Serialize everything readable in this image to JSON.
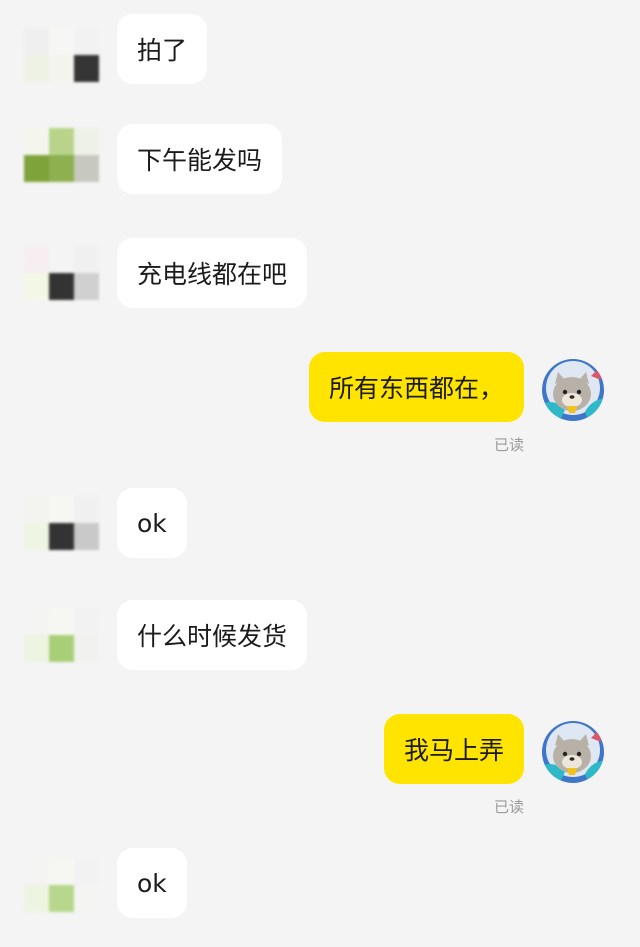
{
  "messages": [
    {
      "side": "in",
      "text": "拍了"
    },
    {
      "side": "in",
      "text": "下午能发吗"
    },
    {
      "side": "in",
      "text": "充电线都在吧"
    },
    {
      "side": "out",
      "text": "所有东西都在，",
      "status": "已读"
    },
    {
      "side": "in",
      "text": "ok"
    },
    {
      "side": "in",
      "text": "什么时候发货"
    },
    {
      "side": "out",
      "text": "我马上弄",
      "status": "已读"
    },
    {
      "side": "in",
      "text": "ok"
    }
  ],
  "colors": {
    "background": "#f4f4f4",
    "incoming_bubble": "#ffffff",
    "outgoing_bubble": "#ffe400",
    "read_status": "#9a9a9a"
  }
}
